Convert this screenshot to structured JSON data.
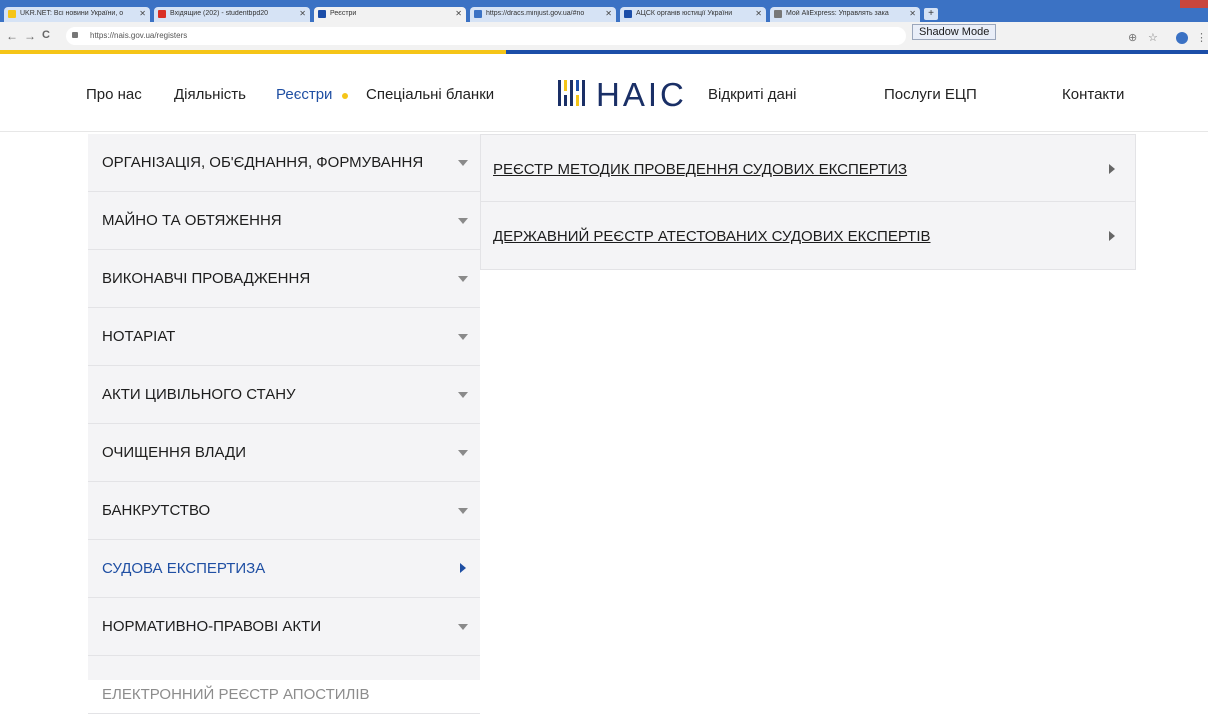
{
  "browser": {
    "tabs": [
      {
        "title": "UKR.NET: Всі новини України, о",
        "favicon_color": "#f5c518"
      },
      {
        "title": "Вхідящие (202) - studentbpd20",
        "favicon_color": "#d93025"
      },
      {
        "title": "Реєстри",
        "favicon_color": "#1c4ea8"
      },
      {
        "title": "https://dracs.minjust.gov.ua/#no",
        "favicon_color": "#3b72c4"
      },
      {
        "title": "АЦСК органів юстиції України",
        "favicon_color": "#1c4ea8"
      },
      {
        "title": "Мой AliExpress: Управлять зака",
        "favicon_color": "#777777"
      }
    ],
    "new_tab_label": "+",
    "shadow_mode_label": "Shadow Mode",
    "url": "https://nais.gov.ua/registers",
    "back_icon": "←",
    "forward_icon": "→",
    "reload_icon": "C",
    "zoom_icon": "⊕",
    "star_icon": "☆",
    "menu_icon": "⋮"
  },
  "doc_bleed_text": "державний реєстр атестованих судових експертів",
  "header": {
    "nav_left": [
      "Про нас",
      "Діяльність",
      "Реєстри",
      "Спеціальні бланки"
    ],
    "logo_text": "HAIC",
    "nav_right": [
      "Відкриті дані",
      "Послуги ЕЦП",
      "Контакти"
    ],
    "accent_yellow": "#f5c518",
    "accent_blue": "#1c4ea8"
  },
  "left_menu": {
    "items": [
      {
        "label": "ОРГАНІЗАЦІЯ, ОБ'ЄДНАННЯ, ФОРМУВАННЯ",
        "state": "collapsed"
      },
      {
        "label": "МАЙНО ТА ОБТЯЖЕННЯ",
        "state": "collapsed"
      },
      {
        "label": "ВИКОНАВЧІ ПРОВАДЖЕННЯ",
        "state": "collapsed"
      },
      {
        "label": "НОТАРІАТ",
        "state": "collapsed"
      },
      {
        "label": "АКТИ ЦИВІЛЬНОГО СТАНУ",
        "state": "collapsed"
      },
      {
        "label": "ОЧИЩЕННЯ ВЛАДИ",
        "state": "collapsed"
      },
      {
        "label": "БАНКРУТСТВО",
        "state": "collapsed"
      },
      {
        "label": "СУДОВА ЕКСПЕРТИЗА",
        "state": "active"
      },
      {
        "label": "НОРМАТИВНО-ПРАВОВІ АКТИ",
        "state": "collapsed"
      },
      {
        "label": "ЕЛЕКТРОННИЙ РЕЄСТР АПОСТИЛІВ",
        "state": "partial"
      }
    ]
  },
  "submenu": {
    "items": [
      {
        "label": "РЕЄСТР МЕТОДИК ПРОВЕДЕННЯ СУДОВИХ ЕКСПЕРТИЗ"
      },
      {
        "label": "ДЕРЖАВНИЙ РЕЄСТР АТЕСТОВАНИХ СУДОВИХ ЕКСПЕРТІВ"
      }
    ]
  }
}
